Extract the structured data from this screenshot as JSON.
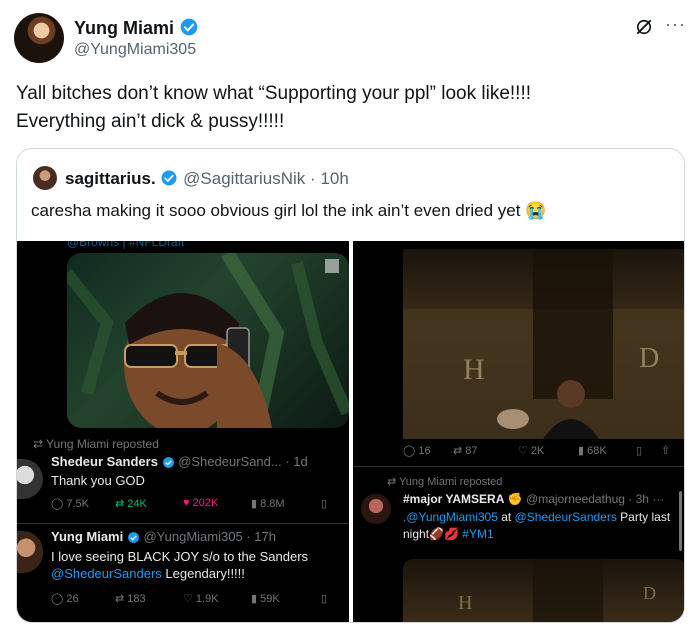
{
  "author": {
    "name": "Yung Miami",
    "handle": "@YungMiami305"
  },
  "tweet": {
    "line1": "Yall bitches don’t know what “Supporting your ppl” look like!!!!",
    "line2": "Everything ain’t dick & pussy!!!!!"
  },
  "quote": {
    "name": "sagittarius.",
    "handle": "@SagittariusNik",
    "time": "10h",
    "text": "caresha making it sooo obvious girl lol the ink ain’t even dried yet 😭"
  },
  "left_media": {
    "top_text": "@Browns | #NFLDraft",
    "repost_label": "Yung Miami reposted",
    "post1": {
      "name": "Shedeur Sanders",
      "handle": "@ShedeurSand...",
      "time": "1d",
      "text": "Thank you GOD",
      "replies": "7.5K",
      "reposts": "24K",
      "likes": "202K",
      "views": "8.8M"
    },
    "post2": {
      "name": "Yung Miami",
      "handle": "@YungMiami305",
      "time": "17h",
      "line1": "I love seeing BLACK JOY s/o to the Sanders",
      "mention": "@ShedeurSanders",
      "line2_rest": " Legendary!!!!!",
      "replies": "26",
      "reposts": "183",
      "likes": "1.9K",
      "views": "59K"
    }
  },
  "right_media": {
    "stats": {
      "replies": "16",
      "reposts": "87",
      "likes": "2K",
      "views": "68K"
    },
    "repost_label": "Yung Miami reposted",
    "post": {
      "name": "#major YAMSERA",
      "handle": "@majorneedathug",
      "time": "3h",
      "mention1": ".@YungMiami305",
      "mid": " at ",
      "mention2": "@ShedeurSanders",
      "rest": " Party last",
      "line2": "night",
      "tag": "#YM1"
    }
  },
  "colors": {
    "blue": "#1d9bf0",
    "verified": "#1d9bf0",
    "like_pink": "#f91880",
    "repost_green": "#00ba7c"
  }
}
